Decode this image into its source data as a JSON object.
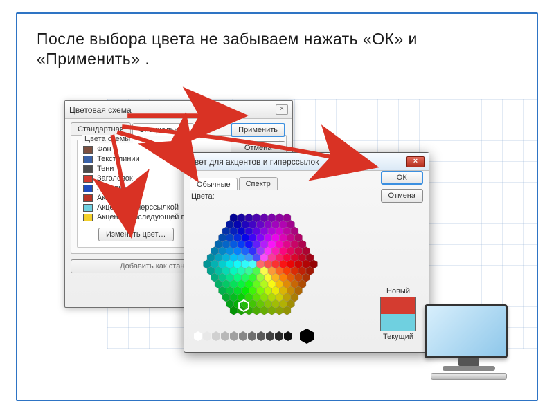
{
  "instruction": "После  выбора  цвета  не  забываем  нажать   «ОК»  и «Применить» .",
  "scheme_dialog": {
    "title": "Цветовая схема",
    "tabs": {
      "standard": "Стандартная",
      "custom": "Специальная"
    },
    "group_title": "Цвета схемы",
    "items": [
      {
        "label": "Фон",
        "color": "#7d4f3f"
      },
      {
        "label": "Текст/линии",
        "color": "#3a62a8"
      },
      {
        "label": "Тени",
        "color": "#4c4c4c"
      },
      {
        "label": "Заголовок",
        "color": "#d23a2e"
      },
      {
        "label": "Заливка",
        "color": "#1f4dbf"
      },
      {
        "label": "Акцент",
        "color": "#b93426"
      },
      {
        "label": "Акцент с гиперссылкой",
        "color": "#6fd0e0"
      },
      {
        "label": "Акцент с последующей гиперссылкой",
        "color": "#f3d02a"
      }
    ],
    "change_color": "Изменить цвет…",
    "add_standard": "Добавить как стандартную схему",
    "apply": "Применить",
    "cancel": "Отмена"
  },
  "color_dialog": {
    "title": "Цвет для акцентов и гиперссылок",
    "tabs": {
      "normal": "Обычные",
      "spectrum": "Спектр"
    },
    "colors_label": "Цвета:",
    "ok": "ОК",
    "cancel": "Отмена",
    "new_label": "Новый",
    "current_label": "Текущий",
    "new_color": "#d43c30",
    "current_color": "#6fd0e0"
  },
  "icons": {
    "close": "×"
  },
  "gray_hexes": [
    "#ffffff",
    "#e8e8e8",
    "#d0d0d0",
    "#b8b8b8",
    "#a0a0a0",
    "#888888",
    "#707070",
    "#585858",
    "#404040",
    "#282828",
    "#101010",
    "#000000"
  ]
}
